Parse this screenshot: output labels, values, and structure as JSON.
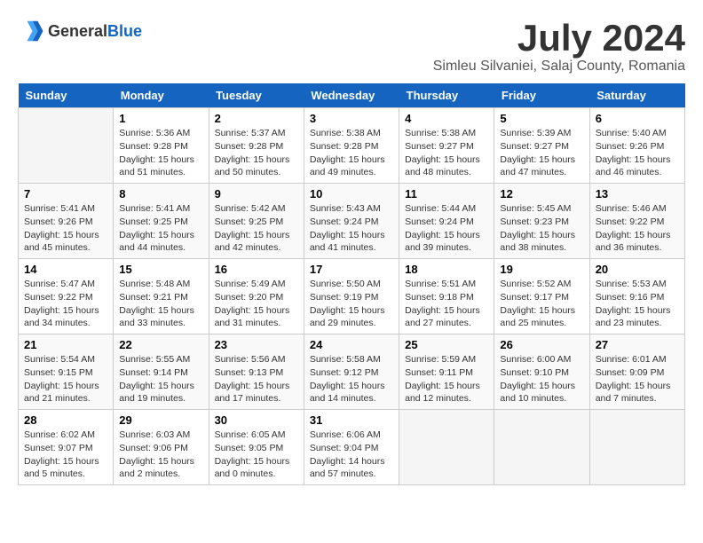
{
  "header": {
    "logo_general": "General",
    "logo_blue": "Blue",
    "month_title": "July 2024",
    "location": "Simleu Silvaniei, Salaj County, Romania"
  },
  "calendar": {
    "days_of_week": [
      "Sunday",
      "Monday",
      "Tuesday",
      "Wednesday",
      "Thursday",
      "Friday",
      "Saturday"
    ],
    "weeks": [
      [
        {
          "day": "",
          "info": ""
        },
        {
          "day": "1",
          "info": "Sunrise: 5:36 AM\nSunset: 9:28 PM\nDaylight: 15 hours\nand 51 minutes."
        },
        {
          "day": "2",
          "info": "Sunrise: 5:37 AM\nSunset: 9:28 PM\nDaylight: 15 hours\nand 50 minutes."
        },
        {
          "day": "3",
          "info": "Sunrise: 5:38 AM\nSunset: 9:28 PM\nDaylight: 15 hours\nand 49 minutes."
        },
        {
          "day": "4",
          "info": "Sunrise: 5:38 AM\nSunset: 9:27 PM\nDaylight: 15 hours\nand 48 minutes."
        },
        {
          "day": "5",
          "info": "Sunrise: 5:39 AM\nSunset: 9:27 PM\nDaylight: 15 hours\nand 47 minutes."
        },
        {
          "day": "6",
          "info": "Sunrise: 5:40 AM\nSunset: 9:26 PM\nDaylight: 15 hours\nand 46 minutes."
        }
      ],
      [
        {
          "day": "7",
          "info": "Sunrise: 5:41 AM\nSunset: 9:26 PM\nDaylight: 15 hours\nand 45 minutes."
        },
        {
          "day": "8",
          "info": "Sunrise: 5:41 AM\nSunset: 9:25 PM\nDaylight: 15 hours\nand 44 minutes."
        },
        {
          "day": "9",
          "info": "Sunrise: 5:42 AM\nSunset: 9:25 PM\nDaylight: 15 hours\nand 42 minutes."
        },
        {
          "day": "10",
          "info": "Sunrise: 5:43 AM\nSunset: 9:24 PM\nDaylight: 15 hours\nand 41 minutes."
        },
        {
          "day": "11",
          "info": "Sunrise: 5:44 AM\nSunset: 9:24 PM\nDaylight: 15 hours\nand 39 minutes."
        },
        {
          "day": "12",
          "info": "Sunrise: 5:45 AM\nSunset: 9:23 PM\nDaylight: 15 hours\nand 38 minutes."
        },
        {
          "day": "13",
          "info": "Sunrise: 5:46 AM\nSunset: 9:22 PM\nDaylight: 15 hours\nand 36 minutes."
        }
      ],
      [
        {
          "day": "14",
          "info": "Sunrise: 5:47 AM\nSunset: 9:22 PM\nDaylight: 15 hours\nand 34 minutes."
        },
        {
          "day": "15",
          "info": "Sunrise: 5:48 AM\nSunset: 9:21 PM\nDaylight: 15 hours\nand 33 minutes."
        },
        {
          "day": "16",
          "info": "Sunrise: 5:49 AM\nSunset: 9:20 PM\nDaylight: 15 hours\nand 31 minutes."
        },
        {
          "day": "17",
          "info": "Sunrise: 5:50 AM\nSunset: 9:19 PM\nDaylight: 15 hours\nand 29 minutes."
        },
        {
          "day": "18",
          "info": "Sunrise: 5:51 AM\nSunset: 9:18 PM\nDaylight: 15 hours\nand 27 minutes."
        },
        {
          "day": "19",
          "info": "Sunrise: 5:52 AM\nSunset: 9:17 PM\nDaylight: 15 hours\nand 25 minutes."
        },
        {
          "day": "20",
          "info": "Sunrise: 5:53 AM\nSunset: 9:16 PM\nDaylight: 15 hours\nand 23 minutes."
        }
      ],
      [
        {
          "day": "21",
          "info": "Sunrise: 5:54 AM\nSunset: 9:15 PM\nDaylight: 15 hours\nand 21 minutes."
        },
        {
          "day": "22",
          "info": "Sunrise: 5:55 AM\nSunset: 9:14 PM\nDaylight: 15 hours\nand 19 minutes."
        },
        {
          "day": "23",
          "info": "Sunrise: 5:56 AM\nSunset: 9:13 PM\nDaylight: 15 hours\nand 17 minutes."
        },
        {
          "day": "24",
          "info": "Sunrise: 5:58 AM\nSunset: 9:12 PM\nDaylight: 15 hours\nand 14 minutes."
        },
        {
          "day": "25",
          "info": "Sunrise: 5:59 AM\nSunset: 9:11 PM\nDaylight: 15 hours\nand 12 minutes."
        },
        {
          "day": "26",
          "info": "Sunrise: 6:00 AM\nSunset: 9:10 PM\nDaylight: 15 hours\nand 10 minutes."
        },
        {
          "day": "27",
          "info": "Sunrise: 6:01 AM\nSunset: 9:09 PM\nDaylight: 15 hours\nand 7 minutes."
        }
      ],
      [
        {
          "day": "28",
          "info": "Sunrise: 6:02 AM\nSunset: 9:07 PM\nDaylight: 15 hours\nand 5 minutes."
        },
        {
          "day": "29",
          "info": "Sunrise: 6:03 AM\nSunset: 9:06 PM\nDaylight: 15 hours\nand 2 minutes."
        },
        {
          "day": "30",
          "info": "Sunrise: 6:05 AM\nSunset: 9:05 PM\nDaylight: 15 hours\nand 0 minutes."
        },
        {
          "day": "31",
          "info": "Sunrise: 6:06 AM\nSunset: 9:04 PM\nDaylight: 14 hours\nand 57 minutes."
        },
        {
          "day": "",
          "info": ""
        },
        {
          "day": "",
          "info": ""
        },
        {
          "day": "",
          "info": ""
        }
      ]
    ]
  }
}
